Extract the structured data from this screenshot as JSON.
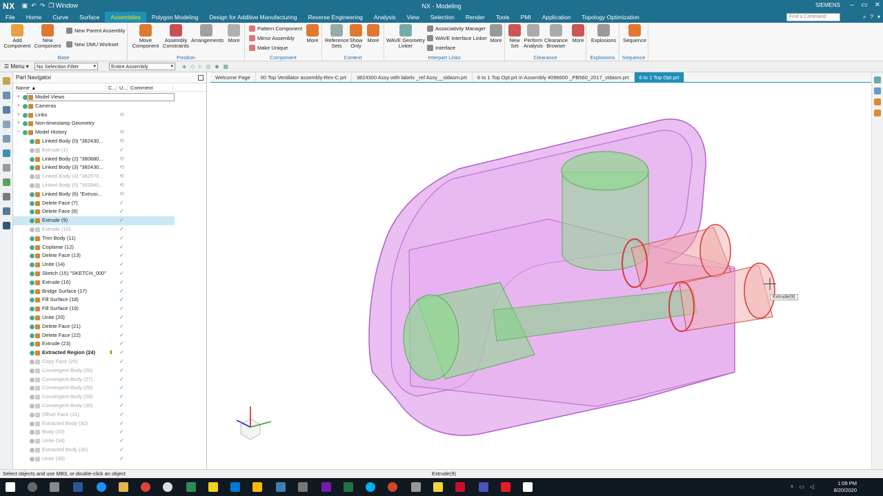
{
  "titlebar": {
    "logo": "NX",
    "window_menu": "Window",
    "title": "NX - Modeling"
  },
  "menubar": {
    "tabs": [
      "File",
      "Home",
      "Curve",
      "Surface",
      "Assemblies",
      "Polygon Modeling",
      "Design for Additive Manufacturing",
      "Reverse Engineering",
      "Analysis",
      "View",
      "Selection",
      "Render",
      "Tools",
      "PMI",
      "Application",
      "Topology Optimization"
    ],
    "active": "Assemblies",
    "brand": "SIEMENS",
    "command_finder_placeholder": "Find a Command"
  },
  "ribbon": {
    "base": {
      "label": "Base",
      "add_component": "Add Component",
      "new_component": "New Component",
      "new_parent_assembly": "New Parent Assembly",
      "new_dmu_worksets": "New DMU Workset"
    },
    "position": {
      "label": "Position",
      "move_component": "Move Component",
      "assembly_constraints": "Assembly Constraints",
      "arrangements": "Arrangements",
      "more": "More"
    },
    "component": {
      "label": "Component",
      "pattern_component": "Pattern Component",
      "mirror_assembly": "Mirror Assembly",
      "make_unique": "Make Unique",
      "more": "More"
    },
    "context": {
      "label": "Context",
      "reference_sets": "Reference Sets",
      "show_only": "Show Only",
      "more": "More"
    },
    "interpart": {
      "label": "Interpart Links",
      "wave_geometry_linker": "WAVE Geometry Linker",
      "associativity_manager": "Associativity Manager",
      "wave_interface_linker": "WAVE Interface Linker",
      "interface": "Interface",
      "more": "More"
    },
    "clearance": {
      "label": "Clearance",
      "new_set": "New Set",
      "perform_analysis": "Perform Analysis",
      "clearance_browser": "Clearance Browser",
      "more": "More"
    },
    "explosions": {
      "label": "Explosions",
      "explosions": "Explosions"
    },
    "sequence": {
      "label": "Sequence",
      "sequence": "Sequence"
    }
  },
  "selbar": {
    "menu": "Menu",
    "filter": "No Selection Filter",
    "scope": "Entire Assembly"
  },
  "navigator": {
    "title": "Part Navigator",
    "col_name": "Name",
    "col_c": "C...",
    "col_u": "U...",
    "col_comment": "Comment",
    "rows": [
      {
        "label": "Model Views",
        "indent": 0,
        "exp": "+",
        "dim": false,
        "bold": false,
        "mark": ""
      },
      {
        "label": "Cameras",
        "indent": 0,
        "exp": "+",
        "dim": false,
        "bold": false,
        "mark": ""
      },
      {
        "label": "Links",
        "indent": 0,
        "exp": "+",
        "dim": false,
        "bold": false,
        "mark": "upd"
      },
      {
        "label": "Non-timestamp Geometry",
        "indent": 0,
        "exp": "+",
        "dim": false,
        "bold": false,
        "mark": ""
      },
      {
        "label": "Model History",
        "indent": 0,
        "exp": "−",
        "dim": false,
        "bold": false,
        "mark": "upd"
      },
      {
        "label": "Linked Body (0) \"382430...",
        "indent": 1,
        "exp": "",
        "dim": false,
        "bold": false,
        "mark": "upd"
      },
      {
        "label": "Extrude (1)",
        "indent": 1,
        "exp": "",
        "dim": true,
        "bold": false,
        "mark": "chk"
      },
      {
        "label": "Linked Body (2) \"380880...",
        "indent": 1,
        "exp": "",
        "dim": false,
        "bold": false,
        "mark": "upd"
      },
      {
        "label": "Linked Body (3) \"382430...",
        "indent": 1,
        "exp": "",
        "dim": false,
        "bold": false,
        "mark": "upd"
      },
      {
        "label": "Linked Body (4) \"382570...",
        "indent": 1,
        "exp": "",
        "dim": true,
        "bold": false,
        "mark": "upd"
      },
      {
        "label": "Linked Body (5) \"383940...",
        "indent": 1,
        "exp": "",
        "dim": true,
        "bold": false,
        "mark": "upd"
      },
      {
        "label": "Linked Body (6) \"Extrusi...",
        "indent": 1,
        "exp": "",
        "dim": false,
        "bold": false,
        "mark": "upd"
      },
      {
        "label": "Delete Face (7)",
        "indent": 1,
        "exp": "",
        "dim": false,
        "bold": false,
        "mark": "chk"
      },
      {
        "label": "Delete Face (8)",
        "indent": 1,
        "exp": "",
        "dim": false,
        "bold": false,
        "mark": "chk"
      },
      {
        "label": "Extrude (9)",
        "indent": 1,
        "exp": "",
        "dim": false,
        "bold": false,
        "mark": "chk",
        "selected": true
      },
      {
        "label": "Extrude (10)",
        "indent": 1,
        "exp": "",
        "dim": true,
        "bold": false,
        "mark": "chk"
      },
      {
        "label": "Trim Body (11)",
        "indent": 1,
        "exp": "",
        "dim": false,
        "bold": false,
        "mark": "chk"
      },
      {
        "label": "Coplanar (12)",
        "indent": 1,
        "exp": "",
        "dim": false,
        "bold": false,
        "mark": "chk"
      },
      {
        "label": "Delete Face (13)",
        "indent": 1,
        "exp": "",
        "dim": false,
        "bold": false,
        "mark": "chk"
      },
      {
        "label": "Unite (14)",
        "indent": 1,
        "exp": "",
        "dim": false,
        "bold": false,
        "mark": "chk"
      },
      {
        "label": "Sketch (15) \"SKETCH_000\"",
        "indent": 1,
        "exp": "",
        "dim": false,
        "bold": false,
        "mark": "chk"
      },
      {
        "label": "Extrude (16)",
        "indent": 1,
        "exp": "",
        "dim": false,
        "bold": false,
        "mark": "chk"
      },
      {
        "label": "Bridge Surface (17)",
        "indent": 1,
        "exp": "",
        "dim": false,
        "bold": false,
        "mark": "chk"
      },
      {
        "label": "Fill Surface (18)",
        "indent": 1,
        "exp": "",
        "dim": false,
        "bold": false,
        "mark": "chk"
      },
      {
        "label": "Fill Surface (19)",
        "indent": 1,
        "exp": "",
        "dim": false,
        "bold": false,
        "mark": "chk"
      },
      {
        "label": "Unite (20)",
        "indent": 1,
        "exp": "",
        "dim": false,
        "bold": false,
        "mark": "chk"
      },
      {
        "label": "Delete Face (21)",
        "indent": 1,
        "exp": "",
        "dim": false,
        "bold": false,
        "mark": "chk"
      },
      {
        "label": "Delete Face (22)",
        "indent": 1,
        "exp": "",
        "dim": false,
        "bold": false,
        "mark": "chk"
      },
      {
        "label": "Extrude (23)",
        "indent": 1,
        "exp": "",
        "dim": false,
        "bold": false,
        "mark": "chk"
      },
      {
        "label": "Extracted Region (24)",
        "indent": 1,
        "exp": "",
        "dim": false,
        "bold": true,
        "mark": "chk",
        "stat": true
      },
      {
        "label": "Copy Face (25)",
        "indent": 1,
        "exp": "",
        "dim": true,
        "bold": false,
        "mark": "chk"
      },
      {
        "label": "Convergent Body (26)",
        "indent": 1,
        "exp": "",
        "dim": true,
        "bold": false,
        "mark": "chk"
      },
      {
        "label": "Convergent Body (27)",
        "indent": 1,
        "exp": "",
        "dim": true,
        "bold": false,
        "mark": "chk"
      },
      {
        "label": "Convergent Body (28)",
        "indent": 1,
        "exp": "",
        "dim": true,
        "bold": false,
        "mark": "chk"
      },
      {
        "label": "Convergent Body (29)",
        "indent": 1,
        "exp": "",
        "dim": true,
        "bold": false,
        "mark": "chk"
      },
      {
        "label": "Convergent Body (30)",
        "indent": 1,
        "exp": "",
        "dim": true,
        "bold": false,
        "mark": "chk"
      },
      {
        "label": "Offset Face (31)",
        "indent": 1,
        "exp": "",
        "dim": true,
        "bold": false,
        "mark": "chk"
      },
      {
        "label": "Extracted Body (32)",
        "indent": 1,
        "exp": "",
        "dim": true,
        "bold": false,
        "mark": "chk"
      },
      {
        "label": "Body (33)",
        "indent": 1,
        "exp": "",
        "dim": true,
        "bold": false,
        "mark": "chk"
      },
      {
        "label": "Unite (34)",
        "indent": 1,
        "exp": "",
        "dim": true,
        "bold": false,
        "mark": "chk"
      },
      {
        "label": "Extracted Body (35)",
        "indent": 1,
        "exp": "",
        "dim": true,
        "bold": false,
        "mark": "chk"
      },
      {
        "label": "Unite (36)",
        "indent": 1,
        "exp": "",
        "dim": true,
        "bold": false,
        "mark": "chk"
      }
    ]
  },
  "doctabs": {
    "tabs": [
      "Welcome Page",
      "00 Top Ventilator assembly-Rev-C.prt",
      "3824300 Assy with labels _ref Assy__sldasm.prt",
      "6 to 1 Top Opt.prt in Assembly 4096600 _PB560_2017_sldasm.prt",
      "6 to 1 Top Opt.prt"
    ],
    "active_index": 4
  },
  "viewport": {
    "tooltip": "Extrude(9)"
  },
  "status": {
    "prompt": "Select objects and use MB3, or double-click an object",
    "selected": "Extrude(9)"
  },
  "taskbar": {
    "time": "1:09 PM",
    "date": "8/20/2020"
  },
  "colors": {
    "title_bg": "#1f6f8f",
    "active_tab": "#ffe600",
    "part_pink": "#d87ae6",
    "part_green": "#7fd37f",
    "part_red": "#e05555"
  }
}
